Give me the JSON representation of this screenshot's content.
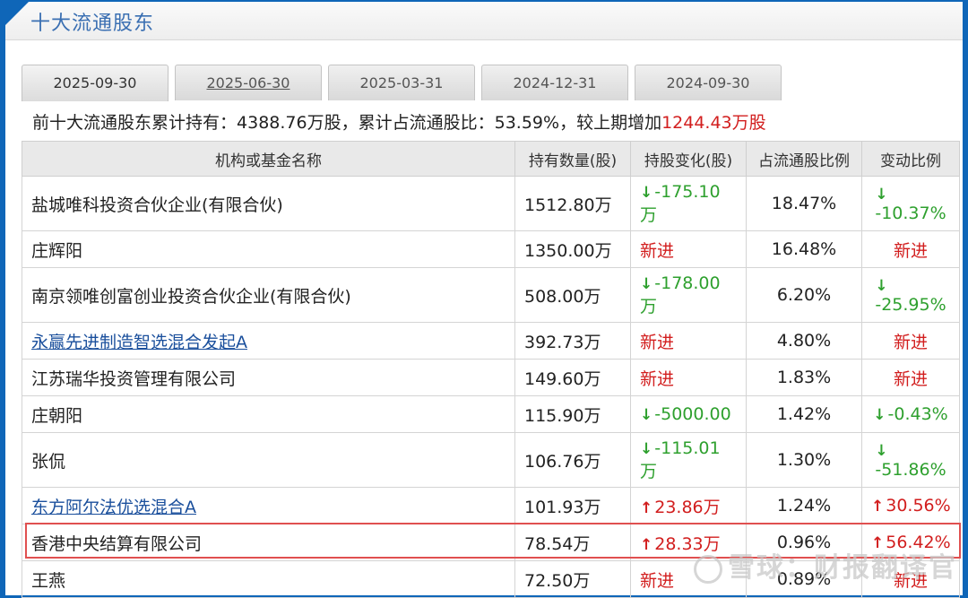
{
  "header": {
    "title": "十大流通股东"
  },
  "tabs": [
    {
      "label": "2025-09-30",
      "active": true
    },
    {
      "label": "2025-06-30",
      "active": false
    },
    {
      "label": "2025-03-31",
      "active": false
    },
    {
      "label": "2024-12-31",
      "active": false
    },
    {
      "label": "2024-09-30",
      "active": false
    }
  ],
  "summary": {
    "prefix": "前十大流通股东累计持有：",
    "total_holding": "4388.76万股",
    "ratio_label": "，累计占流通股比：",
    "ratio_value": "53.59%",
    "change_label": "，较上期增加",
    "change_value": "1244.43万股"
  },
  "table": {
    "headers": [
      "机构或基金名称",
      "持有数量(股)",
      "持股变化(股)",
      "占流通股比例",
      "变动比例"
    ],
    "rows": [
      {
        "name": "盐城唯科投资合伙企业(有限合伙)",
        "link": false,
        "quantity": "1512.80万",
        "change": "-175.10万",
        "change_dir": "down",
        "pct": "18.47%",
        "ratio": "-10.37%",
        "ratio_dir": "down"
      },
      {
        "name": "庄辉阳",
        "link": false,
        "quantity": "1350.00万",
        "change": "新进",
        "change_dir": "new",
        "pct": "16.48%",
        "ratio": "新进",
        "ratio_dir": "new"
      },
      {
        "name": "南京领唯创富创业投资合伙企业(有限合伙)",
        "link": false,
        "quantity": "508.00万",
        "change": "-178.00万",
        "change_dir": "down",
        "pct": "6.20%",
        "ratio": "-25.95%",
        "ratio_dir": "down"
      },
      {
        "name": "永赢先进制造智选混合发起A",
        "link": true,
        "quantity": "392.73万",
        "change": "新进",
        "change_dir": "new",
        "pct": "4.80%",
        "ratio": "新进",
        "ratio_dir": "new"
      },
      {
        "name": "江苏瑞华投资管理有限公司",
        "link": false,
        "quantity": "149.60万",
        "change": "新进",
        "change_dir": "new",
        "pct": "1.83%",
        "ratio": "新进",
        "ratio_dir": "new"
      },
      {
        "name": "庄朝阳",
        "link": false,
        "quantity": "115.90万",
        "change": "-5000.00",
        "change_dir": "down",
        "pct": "1.42%",
        "ratio": "-0.43%",
        "ratio_dir": "down"
      },
      {
        "name": "张侃",
        "link": false,
        "quantity": "106.76万",
        "change": "-115.01万",
        "change_dir": "down",
        "pct": "1.30%",
        "ratio": "-51.86%",
        "ratio_dir": "down"
      },
      {
        "name": "东方阿尔法优选混合A",
        "link": true,
        "quantity": "101.93万",
        "change": "23.86万",
        "change_dir": "up",
        "pct": "1.24%",
        "ratio": "30.56%",
        "ratio_dir": "up"
      },
      {
        "name": "香港中央结算有限公司",
        "link": false,
        "quantity": "78.54万",
        "change": "28.33万",
        "change_dir": "up",
        "pct": "0.96%",
        "ratio": "56.42%",
        "ratio_dir": "up",
        "highlight": true
      },
      {
        "name": "王燕",
        "link": false,
        "quantity": "72.50万",
        "change": "新进",
        "change_dir": "new",
        "pct": "0.89%",
        "ratio": "新进",
        "ratio_dir": "new"
      }
    ]
  },
  "watermark": {
    "text": "雪球：财报翻译官",
    "icon": "xueqiu-logo-icon"
  },
  "colors": {
    "up": "#d21e1e",
    "down": "#2ea02e",
    "link": "#1a4f9c",
    "accent": "#0f66b8"
  }
}
